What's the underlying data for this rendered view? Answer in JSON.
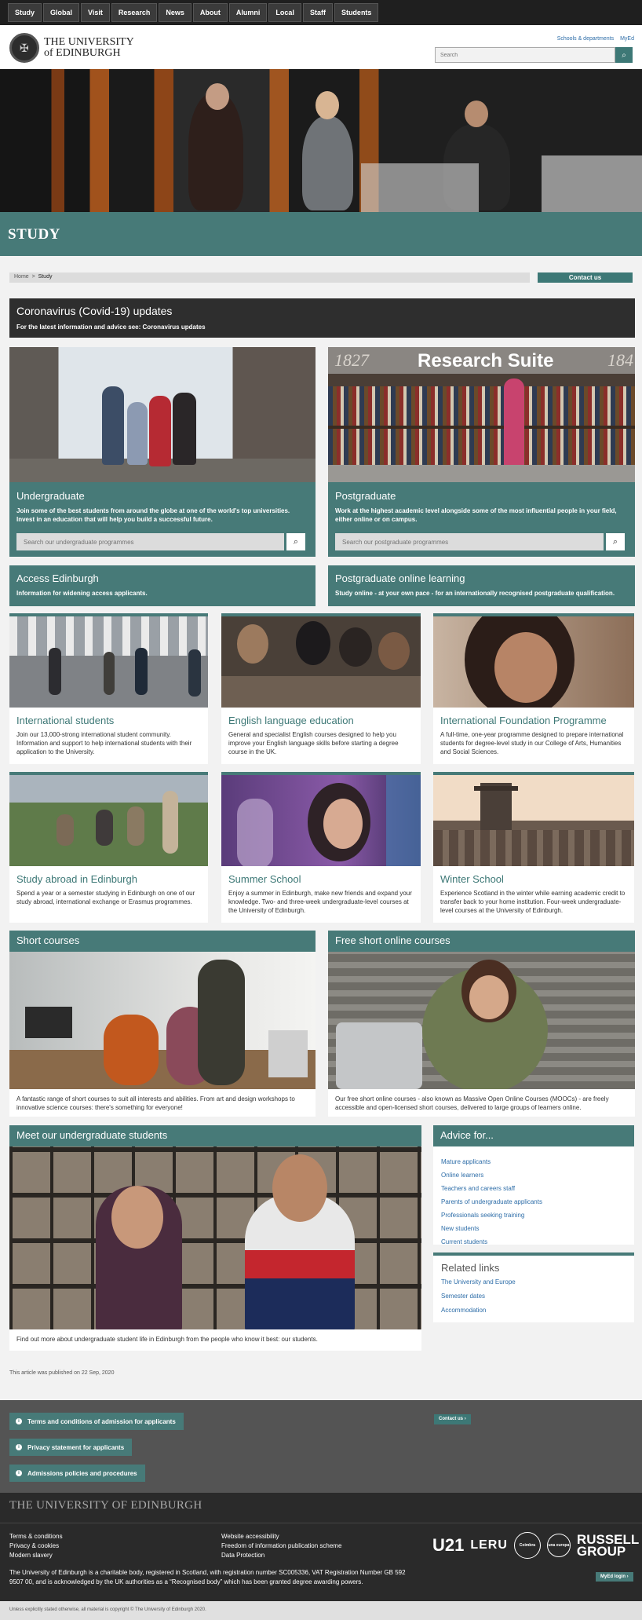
{
  "topnav": [
    "Study",
    "Global",
    "Visit",
    "Research",
    "News",
    "About",
    "Alumni",
    "Local",
    "Staff",
    "Students"
  ],
  "header": {
    "logo_line1": "THE UNIVERSITY",
    "logo_line2": "of EDINBURGH",
    "schools_link": "Schools & departments",
    "myed_link": "MyEd",
    "search_placeholder": "Search"
  },
  "page_title": "STUDY",
  "breadcrumb": {
    "home": "Home",
    "sep": ">",
    "current": "Study"
  },
  "contact_button": "Contact us",
  "covid": {
    "title": "Coronavirus (Covid-19) updates",
    "text": "For the latest information and advice see:",
    "link": "Coronavirus updates"
  },
  "undergraduate": {
    "title": "Undergraduate",
    "text": "Join some of the best students from around the globe at one of the world's top universities. Invest in an education that will help you build a successful future.",
    "search_placeholder": "Search our undergraduate programmes"
  },
  "postgraduate": {
    "title": "Postgraduate",
    "text": "Work at the highest academic level alongside some of the most influential people in your field, either online or on campus.",
    "search_placeholder": "Search our postgraduate programmes",
    "sign": "Research Suite",
    "year_left": "1827",
    "year_right": "184"
  },
  "access": {
    "title": "Access Edinburgh",
    "text": "Information for widening access applicants."
  },
  "pg_online": {
    "title": "Postgraduate online learning",
    "text": "Study online - at your own pace - for an internationally recognised postgraduate qualification."
  },
  "tiles": [
    {
      "title": "International students",
      "text": "Join our 13,000-strong international student community. Information and support to help international students with their application to the University."
    },
    {
      "title": "English language education",
      "text": "General and specialist English courses designed to help you improve your English language skills before starting a degree course in the UK."
    },
    {
      "title": "International Foundation Programme",
      "text": "A full-time, one-year programme designed to prepare international students for degree-level study in our College of Arts, Humanities and Social Sciences."
    },
    {
      "title": "Study abroad in Edinburgh",
      "text": "Spend a year or a semester studying in Edinburgh on one of our study abroad, international exchange or Erasmus programmes."
    },
    {
      "title": "Summer School",
      "text": "Enjoy a summer in Edinburgh, make new friends and expand your knowledge. Two- and three-week undergraduate-level courses at the University of Edinburgh."
    },
    {
      "title": "Winter School",
      "text": "Experience Scotland in the winter while earning academic credit to transfer back to your home institution. Four-week undergraduate-level courses at the University of Edinburgh."
    }
  ],
  "short_courses": {
    "title": "Short courses",
    "text": "A fantastic range of short courses to suit all interests and abilities. From art and design workshops to innovative science courses: there's something for everyone!"
  },
  "free_online": {
    "title": "Free short online courses",
    "text": "Our free short online courses - also known as Massive Open Online Courses (MOOCs) - are freely accessible and open-licensed short courses, delivered to large groups of learners online."
  },
  "meet": {
    "title": "Meet our undergraduate students",
    "text": "Find out more about undergraduate student life in Edinburgh from the people who know it best: our students."
  },
  "advice": {
    "title": "Advice for...",
    "items": [
      "Mature applicants",
      "Online learners",
      "Teachers and careers staff",
      "Parents of undergraduate applicants",
      "Professionals seeking training",
      "New students",
      "Current students"
    ]
  },
  "related": {
    "title": "Related links",
    "items": [
      "The University and Europe",
      "Semester dates",
      "Accommodation"
    ]
  },
  "published": "This article was published on 22 Sep, 2020",
  "footer_buttons": [
    "Terms and conditions of admission for applicants",
    "Privacy statement for applicants",
    "Admissions policies and procedures"
  ],
  "footer_contact": "Contact us",
  "footer_title": "THE UNIVERSITY OF EDINBURGH",
  "footer_links_left": [
    "Terms & conditions",
    "Privacy & cookies",
    "Modern slavery"
  ],
  "footer_links_right": [
    "Website accessibility",
    "Freedom of information publication scheme",
    "Data Protection"
  ],
  "partners": [
    "U21",
    "LERU",
    "Coimbra",
    "una europa",
    "RUSSELL GROUP"
  ],
  "charity": "The University of Edinburgh is a charitable body, registered in Scotland, with registration number SC005336, VAT Registration Number GB 592 9507 00, and is acknowledged by the UK authorities as a “Recognised body” which has been granted degree awarding powers.",
  "mylogin": "MyEd login",
  "copyright": "Unless explicitly stated otherwise, all material is copyright © The University of Edinburgh 2020."
}
